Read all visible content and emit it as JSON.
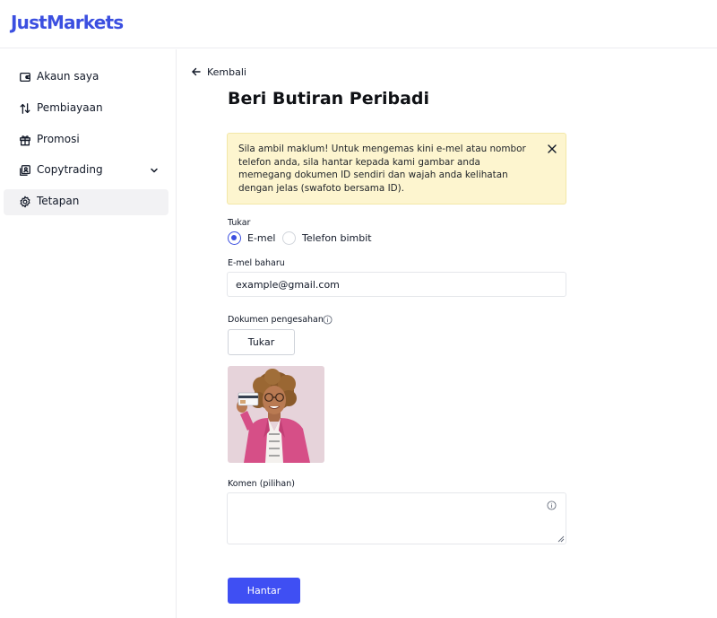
{
  "brand": {
    "logo": "JustMarkets",
    "accent_color": "#3b4fe0"
  },
  "sidebar": {
    "items": [
      {
        "label": "Akaun saya",
        "icon": "wallet-icon",
        "active": false
      },
      {
        "label": "Pembiayaan",
        "icon": "transfer-arrows-icon",
        "active": false
      },
      {
        "label": "Promosi",
        "icon": "gift-icon",
        "active": false
      },
      {
        "label": "Copytrading",
        "icon": "copytrading-icon",
        "active": false,
        "has_submenu": true
      },
      {
        "label": "Tetapan",
        "icon": "gear-icon",
        "active": true
      }
    ]
  },
  "main": {
    "back_label": "Kembali",
    "title": "Beri Butiran Peribadi",
    "alert": {
      "text": "Sila ambil maklum! Untuk mengemas kini e-mel atau nombor telefon anda, sila hantar kepada kami gambar anda memegang dokumen ID sendiri dan wajah anda kelihatan dengan jelas (swafoto bersama ID).",
      "background": "#fdf5cf"
    },
    "change": {
      "label": "Tukar",
      "options": [
        {
          "label": "E-mel",
          "selected": true
        },
        {
          "label": "Telefon bimbit",
          "selected": false
        }
      ]
    },
    "new_email": {
      "label": "E-mel baharu",
      "value": "example@gmail.com"
    },
    "document": {
      "label": "Dokumen pengesahan",
      "change_button": "Tukar"
    },
    "comment": {
      "label": "Komen (pilihan)",
      "value": ""
    },
    "submit_label": "Hantar",
    "submit_color": "#3f4ff3"
  }
}
